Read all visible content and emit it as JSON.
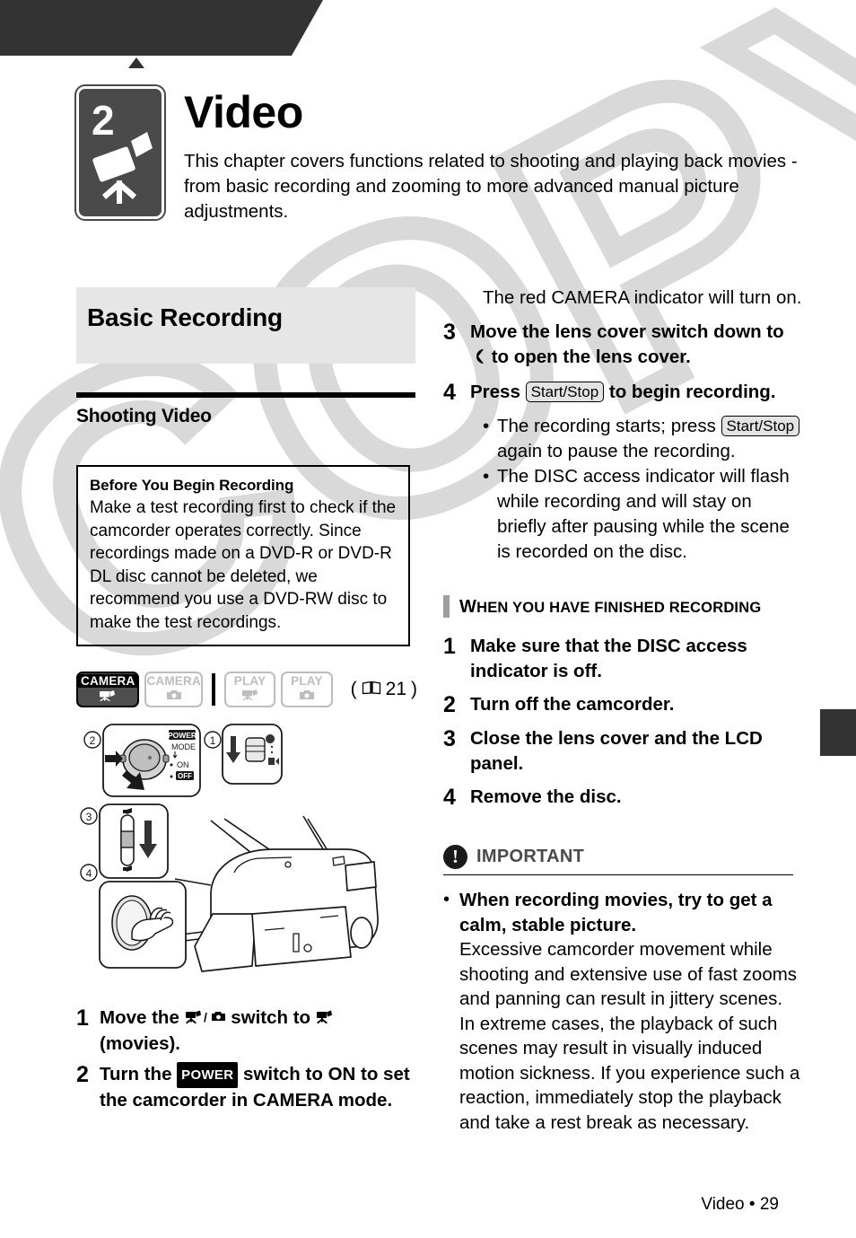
{
  "header": {
    "icons": [
      "unpack-box-icon",
      "camcorder-icon",
      "photo-camera-icon",
      "transfer-arrows-icon",
      "book-icon"
    ],
    "active_icon": "camcorder-icon"
  },
  "chapter": {
    "number": "2",
    "icon": "camcorder-icon",
    "title": "Video",
    "description": "This chapter covers functions related to shooting and playing back movies - from basic recording and zooming to more advanced manual picture adjustments."
  },
  "left": {
    "section_title": "Basic Recording",
    "subsection_title": "Shooting Video",
    "infobox": {
      "title": "Before You Begin Recording",
      "body": "Make a test recording first to check if the camcorder operates correctly. Since recordings made on a DVD-R or DVD-R DL disc cannot be deleted, we recommend you use a DVD-RW disc to make the test recordings."
    },
    "modes": [
      {
        "label": "CAMERA",
        "icon": "movie-icon",
        "state": "active"
      },
      {
        "label": "CAMERA",
        "icon": "photo-icon",
        "state": "off"
      },
      {
        "label": "PLAY",
        "icon": "movie-icon",
        "state": "off"
      },
      {
        "label": "PLAY",
        "icon": "photo-icon",
        "state": "off"
      }
    ],
    "page_ref": "21",
    "page_ref_prefix": "(",
    "page_ref_suffix": ")",
    "diagram": {
      "callouts": [
        "1",
        "2",
        "3",
        "4"
      ],
      "power_label": "POWER",
      "mode_label": "MODE",
      "on_label": "ON",
      "off_label": "OFF"
    },
    "steps": [
      {
        "n": "1",
        "text_a": "Move the ",
        "text_b": " switch to ",
        "text_c": " (movies)."
      },
      {
        "n": "2",
        "text_a": "Turn the ",
        "text_b": " switch to ON to set the camcorder in CAMERA mode."
      }
    ]
  },
  "right": {
    "lead": "The red CAMERA indicator will turn on.",
    "step3": {
      "n": "3",
      "a": "Move the lens cover switch down to ",
      "b": " to open the lens cover."
    },
    "step4": {
      "n": "4",
      "a": "Press ",
      "key": "Start/Stop",
      "b": " to begin recording."
    },
    "bullets": [
      {
        "a": "The recording starts; press ",
        "key": "Start/Stop",
        "b": " again to pause the recording."
      },
      {
        "a": "The DISC access indicator will flash while recording and will stay on briefly after pausing while the scene is recorded on the disc."
      }
    ],
    "when_heading": {
      "first": "W",
      "rest": "HEN YOU HAVE FINISHED RECORDING"
    },
    "when_steps": [
      {
        "n": "1",
        "t": "Make sure that the DISC access indicator is off."
      },
      {
        "n": "2",
        "t": "Turn off the camcorder."
      },
      {
        "n": "3",
        "t": "Close the lens cover and the LCD panel."
      },
      {
        "n": "4",
        "t": "Remove the disc."
      }
    ],
    "important": {
      "icon": "exclamation-icon",
      "glyph": "!",
      "title": "IMPORTANT",
      "bullet_bold": "When recording movies, try to get a calm, stable picture.",
      "bullet_body": "Excessive camcorder movement while shooting and extensive use of fast zooms and panning can result in jittery scenes. In extreme cases, the playback of such scenes may result in visually induced motion sickness. If you experience such a reaction, immediately stop the playback and take a rest break as necessary."
    }
  },
  "footer": {
    "chapter": "Video",
    "separator": "•",
    "page": "29"
  },
  "watermark": {
    "text": "COPY"
  },
  "colors": {
    "banner": "#333333",
    "section_bg": "#e6e6e6",
    "chapter_icon_bg": "#4a4a4a",
    "watermark": "#d9d9d9",
    "bar": "#9e9e9e"
  }
}
